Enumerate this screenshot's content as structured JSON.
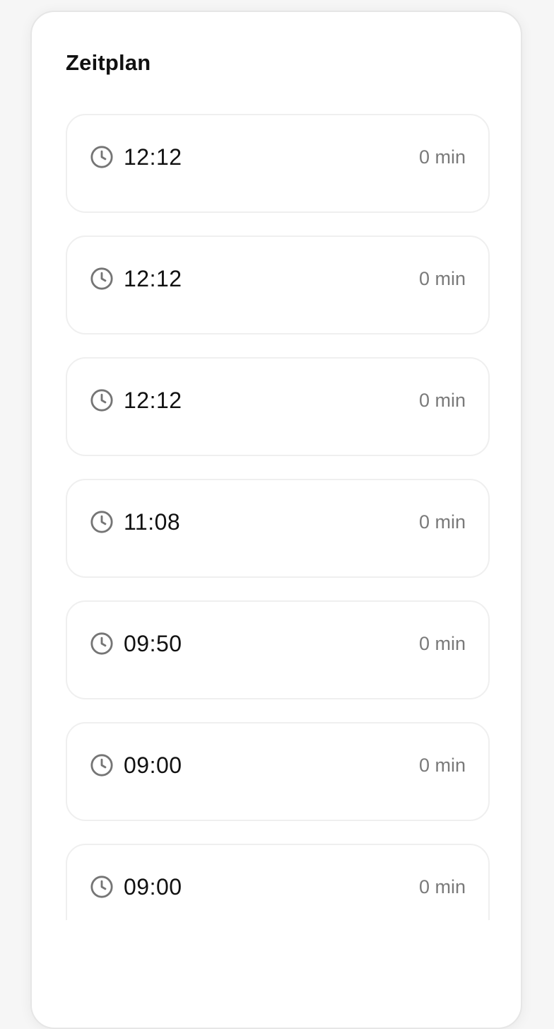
{
  "schedule": {
    "title": "Zeitplan",
    "items": [
      {
        "time": "12:12",
        "duration": "0 min"
      },
      {
        "time": "12:12",
        "duration": "0 min"
      },
      {
        "time": "12:12",
        "duration": "0 min"
      },
      {
        "time": "11:08",
        "duration": "0 min"
      },
      {
        "time": "09:50",
        "duration": "0 min"
      },
      {
        "time": "09:00",
        "duration": "0 min"
      },
      {
        "time": "09:00",
        "duration": "0 min"
      }
    ],
    "icon": "clock-icon",
    "colors": {
      "icon": "#757575",
      "time": "#111111",
      "duration": "#7a7a7a",
      "border": "#efefef"
    }
  }
}
